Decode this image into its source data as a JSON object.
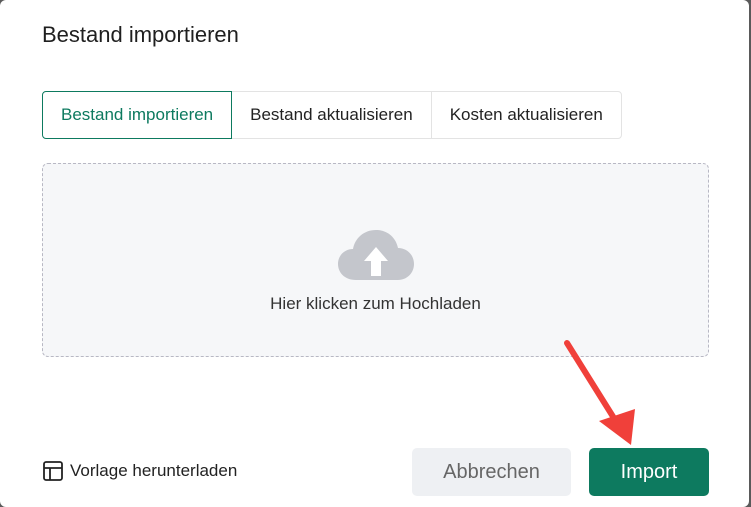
{
  "dialog": {
    "title": "Bestand importieren",
    "tabs": [
      {
        "label": "Bestand importieren",
        "active": true
      },
      {
        "label": "Bestand aktualisieren",
        "active": false
      },
      {
        "label": "Kosten aktualisieren",
        "active": false
      }
    ],
    "upload": {
      "text": "Hier klicken zum Hochladen",
      "icon": "cloud-upload-icon"
    },
    "template_link": {
      "label": "Vorlage herunterladen",
      "icon": "layout-template-icon"
    },
    "buttons": {
      "cancel_label": "Abbrechen",
      "import_label": "Import"
    }
  },
  "colors": {
    "accent": "#0d7a5f",
    "annotation_arrow": "#f0403a"
  }
}
